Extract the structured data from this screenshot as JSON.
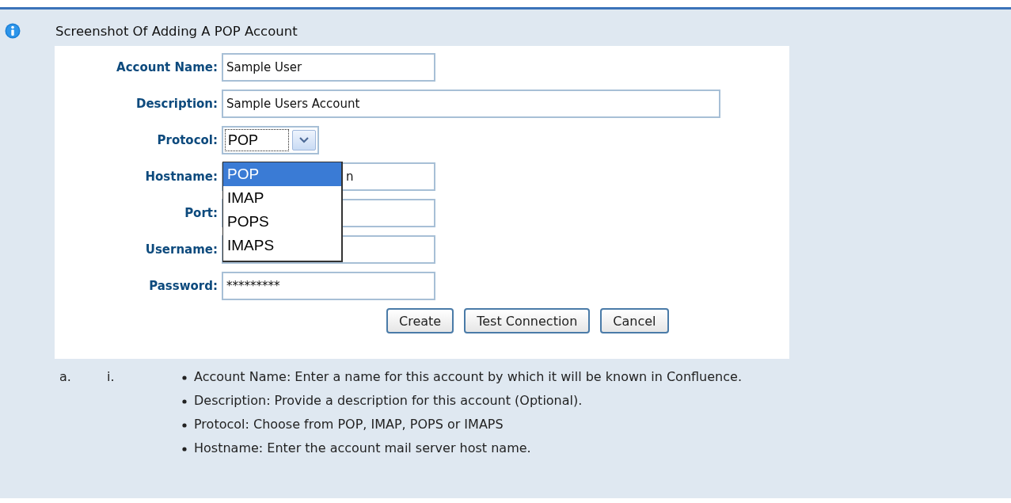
{
  "title": "Screenshot Of Adding A POP Account",
  "form": {
    "fields": [
      {
        "kind": "text",
        "label": "Account Name:",
        "value": "Sample User"
      },
      {
        "kind": "wide",
        "label": "Description:",
        "value": "Sample Users Account"
      },
      {
        "kind": "select",
        "label": "Protocol:",
        "value": "POP"
      },
      {
        "kind": "covered",
        "label": "Hostname:",
        "value": "n"
      },
      {
        "kind": "text",
        "label": "Port:"
      },
      {
        "kind": "text",
        "label": "Username:"
      },
      {
        "kind": "text",
        "label": "Password:",
        "value": "*********"
      }
    ],
    "dropdown": [
      {
        "label": "POP",
        "selected": true
      },
      {
        "label": "IMAP",
        "selected": false
      },
      {
        "label": "POPS",
        "selected": false
      },
      {
        "label": "IMAPS",
        "selected": false
      }
    ],
    "buttons": [
      "Create",
      "Test Connection",
      "Cancel"
    ]
  },
  "notes": {
    "markers": [
      "a.",
      "i."
    ],
    "items": [
      "Account Name: Enter a name for this account by which it will be known in Confluence.",
      "Description: Provide a description for this account (Optional).",
      "Protocol: Choose from POP, IMAP, POPS or IMAPS",
      "Hostname: Enter the account mail server host name."
    ]
  }
}
